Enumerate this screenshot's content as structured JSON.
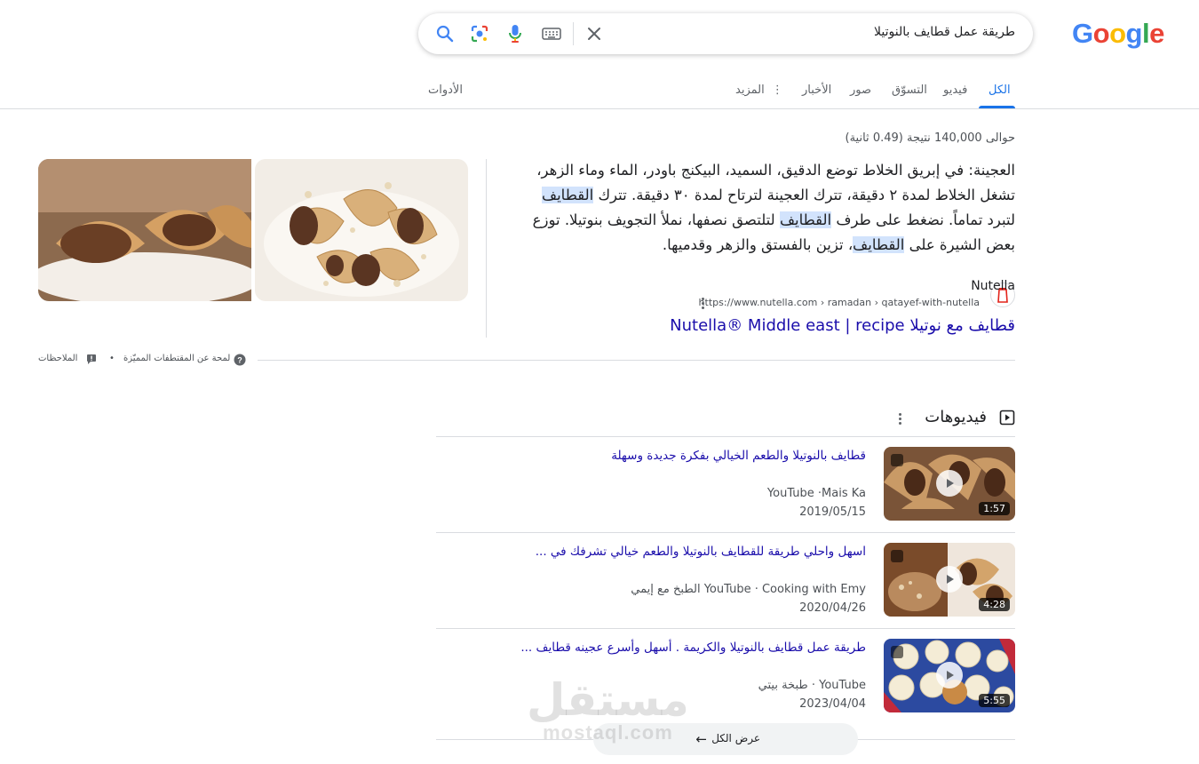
{
  "logo": {
    "g1": "G",
    "o1": "o",
    "o2": "o",
    "g2": "g",
    "l": "l",
    "e": "e"
  },
  "search": {
    "query": "طريقة عمل قطايف بالنوتيلا"
  },
  "tabs": [
    {
      "label": "الكل",
      "active": true
    },
    {
      "label": "فيديو"
    },
    {
      "label": "التسوّق"
    },
    {
      "label": "صور"
    },
    {
      "label": "الأخبار"
    },
    {
      "label": "المزيد"
    },
    {
      "label": "الأدوات"
    }
  ],
  "results": {
    "count": "حوالى 140,000 نتيجة (0.49 ثانية)"
  },
  "snippet": {
    "parts": [
      "العجينة: في إبريق الخلاط توضع الدقيق، السميد، البيكنج باودر، الماء وماء الزهر، تشغل الخلاط لمدة ٢ دقيقة، تترك العجينة لترتاح لمدة ٣٠ دقيقة. تترك ",
      "القطايف",
      " لتبرد تماماً. نضغط على طرف ",
      "القطايف",
      " لتلتصق نصفها، نملأ التجويف بنوتيلا. توزع بعض الشيرة على ",
      "القطايف",
      "، تزين بالفستق والزهر وقدميها."
    ],
    "source_name": "Nutella",
    "source_url": "https://www.nutella.com › ramadan › qatayef-with-nutella",
    "source_title": "قطايف مع نوتيلا Nutella® Middle east | recipe"
  },
  "feedback": {
    "about": "لمحة عن المقتطفات المميّزة",
    "separator": "•",
    "notes": "الملاحظات"
  },
  "videos": {
    "title": "فيديوهات",
    "items": [
      {
        "title": "قطايف بالنوتيلا والطعم الخيالي بفكرة جديدة وسهلة",
        "meta": "YouTube ·Mais Ka",
        "date": "2019/05/15",
        "duration": "1:57"
      },
      {
        "title": "اسهل واحلي طريقة للقطايف بالنوتيلا والطعم خيالي تشرفك في ...",
        "meta": "YouTube · Cooking with Emy الطبخ مع إيمي",
        "date": "2020/04/26",
        "duration": "4:28"
      },
      {
        "title": "طريقة عمل قطايف بالنوتيلا والكريمة . أسهل وأسرع عجينه قطايف ...",
        "meta": "YouTube · طبخة بيتي",
        "date": "2023/04/04",
        "duration": "5:55"
      }
    ],
    "view_all": "عرض الكل"
  },
  "watermark": {
    "arabic": "مستقل",
    "latin": "mostaql.com"
  },
  "colors": {
    "link": "#1a0dab",
    "accent": "#1a73e8",
    "highlight": "#d2e3fc"
  }
}
